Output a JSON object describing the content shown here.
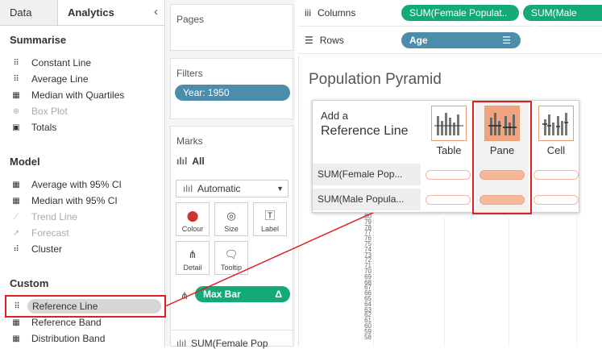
{
  "left_pane": {
    "tabs": [
      {
        "label": "Data"
      },
      {
        "label": "Analytics"
      }
    ],
    "collapse_icon": "chevron-left-icon",
    "sections": {
      "summarise": {
        "title": "Summarise",
        "items": [
          {
            "label": "Constant Line",
            "icon": "constant-line-icon"
          },
          {
            "label": "Average Line",
            "icon": "average-line-icon"
          },
          {
            "label": "Median with Quartiles",
            "icon": "median-quartiles-icon"
          },
          {
            "label": "Box Plot",
            "icon": "box-plot-icon"
          },
          {
            "label": "Totals",
            "icon": "totals-icon"
          }
        ]
      },
      "model": {
        "title": "Model",
        "items": [
          {
            "label": "Average with 95% CI",
            "icon": "average-ci-icon"
          },
          {
            "label": "Median with 95% CI",
            "icon": "median-ci-icon"
          },
          {
            "label": "Trend Line",
            "icon": "trend-line-icon"
          },
          {
            "label": "Forecast",
            "icon": "forecast-icon"
          },
          {
            "label": "Cluster",
            "icon": "cluster-icon"
          }
        ]
      },
      "custom": {
        "title": "Custom",
        "items": [
          {
            "label": "Reference Line",
            "icon": "reference-line-icon"
          },
          {
            "label": "Reference Band",
            "icon": "reference-band-icon"
          },
          {
            "label": "Distribution Band",
            "icon": "distribution-band-icon"
          }
        ]
      }
    }
  },
  "cards": {
    "pages": {
      "title": "Pages"
    },
    "filters": {
      "title": "Filters",
      "pill": "Year: 1950"
    },
    "marks": {
      "title": "Marks",
      "all_label": "All",
      "type_dropdown": "Automatic",
      "buttons": {
        "colour": "Colour",
        "size": "Size",
        "label": "Label",
        "detail": "Detail",
        "tooltip": "Tooltip"
      },
      "field_pill": "Max Bar",
      "field_delta": "Δ",
      "next_item": "SUM(Female Pop"
    }
  },
  "shelves": {
    "columns_label": "Columns",
    "columns_pills": [
      "SUM(Female Populat..",
      "SUM(Male Populat.."
    ],
    "rows_label": "Rows",
    "rows_pill": "Age"
  },
  "viz": {
    "title": "Population Pyramid",
    "age_ticks": [
      "80",
      "79",
      "78",
      "77",
      "76",
      "75",
      "74",
      "73",
      "72",
      "71",
      "70",
      "69",
      "68",
      "67",
      "66",
      "65",
      "64",
      "63",
      "62",
      "61",
      "60",
      "59",
      "58"
    ]
  },
  "popup": {
    "heading_small": "Add a",
    "heading_large": "Reference Line",
    "scopes": [
      {
        "label": "Table",
        "selected": false
      },
      {
        "label": "Pane",
        "selected": true
      },
      {
        "label": "Cell",
        "selected": false
      }
    ],
    "rows": [
      {
        "label": "SUM(Female Pop..."
      },
      {
        "label": "SUM(Male Popula..."
      }
    ]
  },
  "colors": {
    "accent_red": "#e02020",
    "pill_blue": "#4c8dab",
    "pill_green": "#13a978",
    "scope_selected": "#f0a37d"
  }
}
